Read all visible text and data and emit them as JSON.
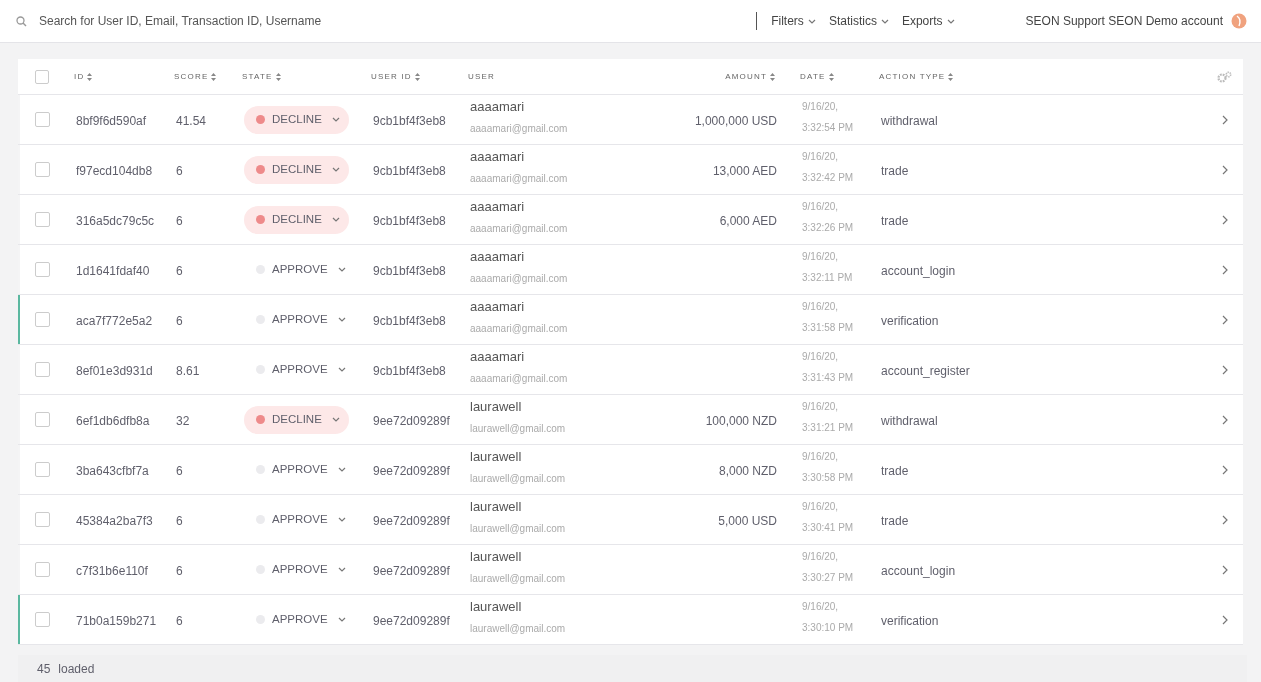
{
  "topbar": {
    "search": {
      "placeholder": "Search for User ID, Email, Transaction ID, Username"
    },
    "menus": [
      "Filters",
      "Statistics",
      "Exports"
    ],
    "account": "SEON Support SEON Demo account"
  },
  "table": {
    "select_all_checked": false,
    "columns": [
      {
        "label": "ID",
        "sortable": true
      },
      {
        "label": "SCORE",
        "sortable": true
      },
      {
        "label": "STATE",
        "sortable": true
      },
      {
        "label": "USER ID",
        "sortable": true
      },
      {
        "label": "USER",
        "sortable": false
      },
      {
        "label": "AMOUNT",
        "sortable": true
      },
      {
        "label": "DATE",
        "sortable": true
      },
      {
        "label": "ACTION TYPE",
        "sortable": true
      }
    ],
    "rows": [
      {
        "id": "8bf9f6d590af",
        "score": "41.54",
        "state": {
          "label": "DECLINE",
          "kind": "decline"
        },
        "user_id": "9cb1bf4f3eb8",
        "user": "aaaamari",
        "email": "aaaamari@gmail.com",
        "amount": "1,000,000 USD",
        "date": "9/16/20,",
        "time": "3:32:54 PM",
        "action_type": "withdrawal",
        "checked": false,
        "highlighted": false
      },
      {
        "id": "f97ecd104db8",
        "score": "6",
        "state": {
          "label": "DECLINE",
          "kind": "decline"
        },
        "user_id": "9cb1bf4f3eb8",
        "user": "aaaamari",
        "email": "aaaamari@gmail.com",
        "amount": "13,000 AED",
        "date": "9/16/20,",
        "time": "3:32:42 PM",
        "action_type": "trade",
        "checked": false,
        "highlighted": false
      },
      {
        "id": "316a5dc79c5c",
        "score": "6",
        "state": {
          "label": "DECLINE",
          "kind": "decline"
        },
        "user_id": "9cb1bf4f3eb8",
        "user": "aaaamari",
        "email": "aaaamari@gmail.com",
        "amount": "6,000 AED",
        "date": "9/16/20,",
        "time": "3:32:26 PM",
        "action_type": "trade",
        "checked": false,
        "highlighted": false
      },
      {
        "id": "1d1641fdaf40",
        "score": "6",
        "state": {
          "label": "APPROVE",
          "kind": "approve"
        },
        "user_id": "9cb1bf4f3eb8",
        "user": "aaaamari",
        "email": "aaaamari@gmail.com",
        "date": "9/16/20,",
        "time": "3:32:11 PM",
        "action_type": "account_login",
        "checked": false,
        "highlighted": false
      },
      {
        "id": "aca7f772e5a2",
        "score": "6",
        "state": {
          "label": "APPROVE",
          "kind": "approve"
        },
        "user_id": "9cb1bf4f3eb8",
        "user": "aaaamari",
        "email": "aaaamari@gmail.com",
        "date": "9/16/20,",
        "time": "3:31:58 PM",
        "action_type": "verification",
        "checked": false,
        "highlighted": true
      },
      {
        "id": "8ef01e3d931d",
        "score": "8.61",
        "state": {
          "label": "APPROVE",
          "kind": "approve"
        },
        "user_id": "9cb1bf4f3eb8",
        "user": "aaaamari",
        "email": "aaaamari@gmail.com",
        "date": "9/16/20,",
        "time": "3:31:43 PM",
        "action_type": "account_register",
        "checked": false,
        "highlighted": false
      },
      {
        "id": "6ef1db6dfb8a",
        "score": "32",
        "state": {
          "label": "DECLINE",
          "kind": "decline"
        },
        "user_id": "9ee72d09289f",
        "user": "laurawell",
        "email": "laurawell@gmail.com",
        "amount": "100,000 NZD",
        "date": "9/16/20,",
        "time": "3:31:21 PM",
        "action_type": "withdrawal",
        "checked": false,
        "highlighted": false
      },
      {
        "id": "3ba643cfbf7a",
        "score": "6",
        "state": {
          "label": "APPROVE",
          "kind": "approve"
        },
        "user_id": "9ee72d09289f",
        "user": "laurawell",
        "email": "laurawell@gmail.com",
        "amount": "8,000 NZD",
        "date": "9/16/20,",
        "time": "3:30:58 PM",
        "action_type": "trade",
        "checked": false,
        "highlighted": false
      },
      {
        "id": "45384a2ba7f3",
        "score": "6",
        "state": {
          "label": "APPROVE",
          "kind": "approve"
        },
        "user_id": "9ee72d09289f",
        "user": "laurawell",
        "email": "laurawell@gmail.com",
        "amount": "5,000 USD",
        "date": "9/16/20,",
        "time": "3:30:41 PM",
        "action_type": "trade",
        "checked": false,
        "highlighted": false
      },
      {
        "id": "c7f31b6e110f",
        "score": "6",
        "state": {
          "label": "APPROVE",
          "kind": "approve"
        },
        "user_id": "9ee72d09289f",
        "user": "laurawell",
        "email": "laurawell@gmail.com",
        "date": "9/16/20,",
        "time": "3:30:27 PM",
        "action_type": "account_login",
        "checked": false,
        "highlighted": false
      },
      {
        "id": "71b0a159b271",
        "score": "6",
        "state": {
          "label": "APPROVE",
          "kind": "approve"
        },
        "user_id": "9ee72d09289f",
        "user": "laurawell",
        "email": "laurawell@gmail.com",
        "date": "9/16/20,",
        "time": "3:30:10 PM",
        "action_type": "verification",
        "checked": false,
        "highlighted": true
      }
    ]
  },
  "footer": {
    "count": "45",
    "label": "loaded"
  }
}
